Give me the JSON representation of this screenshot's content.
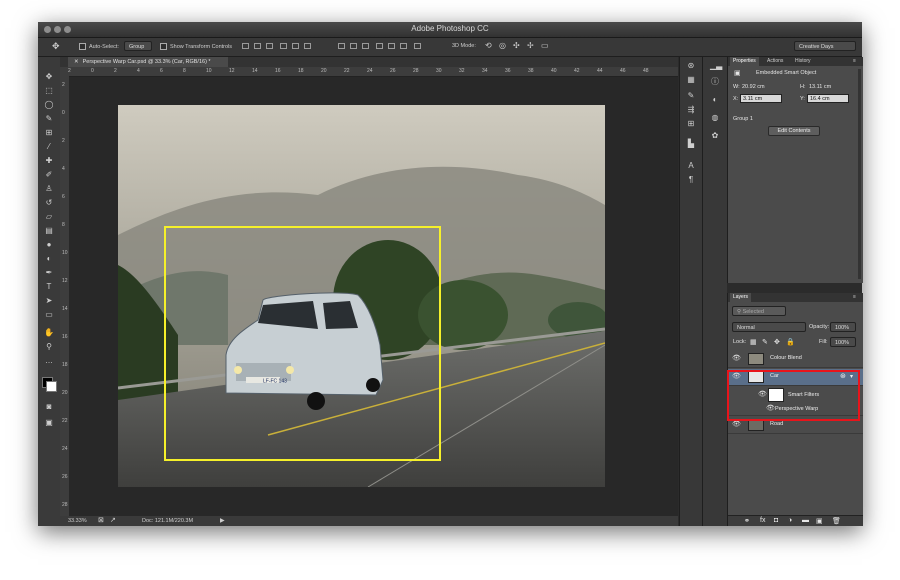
{
  "window": {
    "title": "Adobe Photoshop CC"
  },
  "options_bar": {
    "auto_select_label": "Auto-Select:",
    "auto_select_value": "Group",
    "show_transform_label": "Show Transform Controls",
    "mode_3d_label": "3D Mode:",
    "workspace": "Creative Days"
  },
  "document": {
    "tab_title": "Perspective Warp Car.psd @ 33.3% (Car, RGB/16) *",
    "ruler_h": [
      "2",
      "0",
      "2",
      "4",
      "6",
      "8",
      "10",
      "12",
      "14",
      "16",
      "18",
      "20",
      "22",
      "24",
      "26",
      "28",
      "30",
      "32",
      "34",
      "36",
      "38",
      "40",
      "42",
      "44",
      "46",
      "48"
    ],
    "ruler_v": [
      "2",
      "0",
      "2",
      "4",
      "6",
      "8",
      "10",
      "12",
      "14",
      "16",
      "18",
      "20",
      "22",
      "24",
      "26",
      "28"
    ],
    "plate": "LF-FC 143"
  },
  "status": {
    "zoom": "33.33%",
    "doc": "Doc: 121.1M/220.3M"
  },
  "properties": {
    "tabs": [
      "Properties",
      "Actions",
      "History"
    ],
    "type": "Embedded Smart Object",
    "w_label": "W:",
    "w": "20.92 cm",
    "h_label": "H:",
    "h": "13.11 cm",
    "x_label": "X:",
    "x": "3.11 cm",
    "y_label": "Y:",
    "y": "16.4 cm",
    "group": "Group 1",
    "edit_button": "Edit Contents"
  },
  "layers": {
    "title": "Layers",
    "filter_placeholder": "Selected",
    "blend_mode": "Normal",
    "opacity_label": "Opacity:",
    "opacity": "100%",
    "lock_label": "Lock:",
    "fill_label": "Fill:",
    "fill": "100%",
    "items": [
      {
        "name": "Colour Blend"
      },
      {
        "name": "Car"
      },
      {
        "name": "Smart Filters"
      },
      {
        "name": "Perspective Warp"
      },
      {
        "name": "Road"
      }
    ]
  },
  "colors": {
    "selection_box": "#f5f02a",
    "highlight": "#e8141b",
    "active_layer": "#5a6f8a"
  }
}
